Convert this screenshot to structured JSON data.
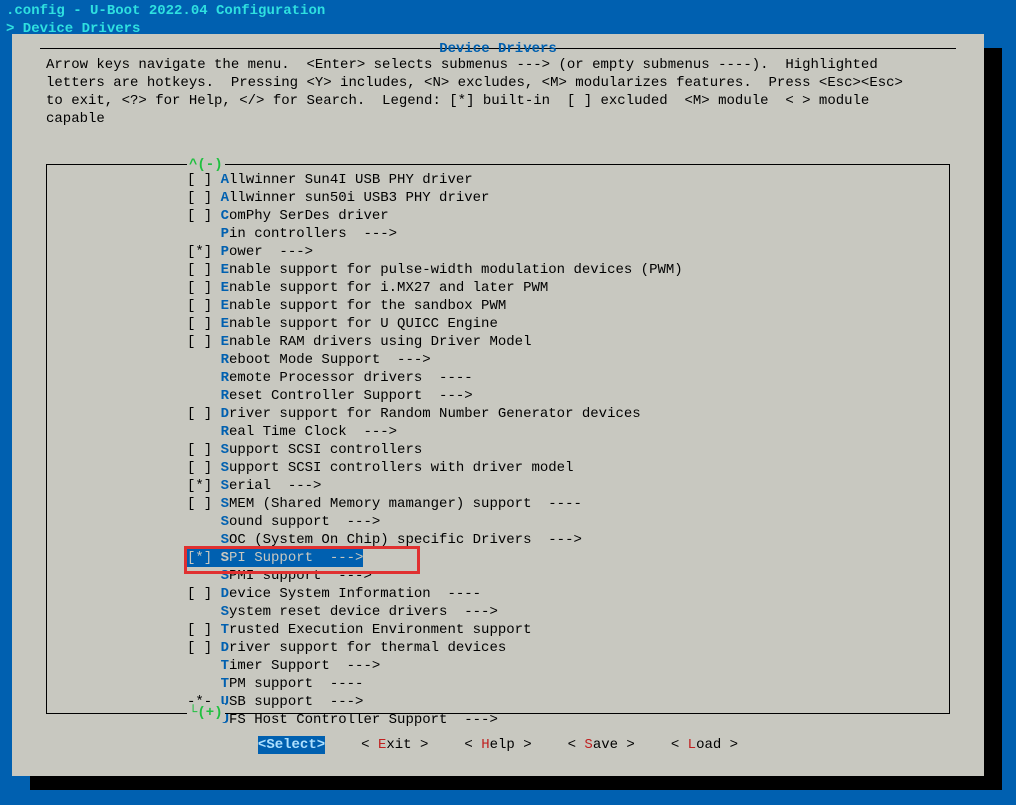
{
  "header": {
    "title": ".config - U-Boot 2022.04 Configuration",
    "breadcrumb": "> Device Drivers"
  },
  "panel": {
    "title": " Device Drivers ",
    "instructions": "Arrow keys navigate the menu.  <Enter> selects submenus ---> (or empty submenus ----).  Highlighted\nletters are hotkeys.  Pressing <Y> includes, <N> excludes, <M> modularizes features.  Press <Esc><Esc>\nto exit, <?> for Help, </> for Search.  Legend: [*] built-in  [ ] excluded  <M> module  < > module\ncapable",
    "scroll_up": "^(-)",
    "scroll_down": "└(+)"
  },
  "items": [
    {
      "prefix": "[ ] ",
      "hk": "A",
      "rest": "llwinner Sun4I USB PHY driver"
    },
    {
      "prefix": "[ ] ",
      "hk": "A",
      "rest": "llwinner sun50i USB3 PHY driver"
    },
    {
      "prefix": "[ ] ",
      "hk": "C",
      "rest": "omPhy SerDes driver"
    },
    {
      "prefix": "    ",
      "hk": "P",
      "rest": "in controllers  --->"
    },
    {
      "prefix": "[*] ",
      "hk": "P",
      "rest": "ower  --->"
    },
    {
      "prefix": "[ ] ",
      "hk": "E",
      "rest": "nable support for pulse-width modulation devices (PWM)"
    },
    {
      "prefix": "[ ] ",
      "hk": "E",
      "rest": "nable support for i.MX27 and later PWM"
    },
    {
      "prefix": "[ ] ",
      "hk": "E",
      "rest": "nable support for the sandbox PWM"
    },
    {
      "prefix": "[ ] ",
      "hk": "E",
      "rest": "nable support for U QUICC Engine"
    },
    {
      "prefix": "[ ] ",
      "hk": "E",
      "rest": "nable RAM drivers using Driver Model"
    },
    {
      "prefix": "    ",
      "hk": "R",
      "rest": "eboot Mode Support  --->"
    },
    {
      "prefix": "    ",
      "hk": "R",
      "rest": "emote Processor drivers  ----"
    },
    {
      "prefix": "    ",
      "hk": "R",
      "rest": "eset Controller Support  --->"
    },
    {
      "prefix": "[ ] ",
      "hk": "D",
      "rest": "river support for Random Number Generator devices"
    },
    {
      "prefix": "    ",
      "hk": "R",
      "rest": "eal Time Clock  --->"
    },
    {
      "prefix": "[ ] ",
      "hk": "S",
      "rest": "upport SCSI controllers"
    },
    {
      "prefix": "[ ] ",
      "hk": "S",
      "rest": "upport SCSI controllers with driver model"
    },
    {
      "prefix": "[*] ",
      "hk": "S",
      "rest": "erial  --->"
    },
    {
      "prefix": "[ ] ",
      "hk": "S",
      "rest": "MEM (Shared Memory mamanger) support  ----"
    },
    {
      "prefix": "    ",
      "hk": "S",
      "rest": "ound support  --->"
    },
    {
      "prefix": "    ",
      "hk": "S",
      "rest": "OC (System On Chip) specific Drivers  --->"
    },
    {
      "prefix": "[*] ",
      "hk": "S",
      "rest": "PI Support  --->",
      "selected": true
    },
    {
      "prefix": "    ",
      "hk": "S",
      "rest": "PMI support  --->"
    },
    {
      "prefix": "[ ] ",
      "hk": "D",
      "rest": "evice System Information  ----"
    },
    {
      "prefix": "    ",
      "hk": "S",
      "rest": "ystem reset device drivers  --->"
    },
    {
      "prefix": "[ ] ",
      "hk": "T",
      "rest": "rusted Execution Environment support"
    },
    {
      "prefix": "[ ] ",
      "hk": "D",
      "rest": "river support for thermal devices"
    },
    {
      "prefix": "    ",
      "hk": "T",
      "rest": "imer Support  --->"
    },
    {
      "prefix": "    ",
      "hk": "T",
      "rest": "PM support  ----"
    },
    {
      "prefix": "-*- ",
      "hk": "U",
      "rest": "SB support  --->"
    },
    {
      "prefix": "    ",
      "hk": "U",
      "rest": "FS Host Controller Support  --->"
    }
  ],
  "buttons": [
    {
      "pre": "<",
      "kw": "Select",
      "post": ">",
      "selected": true
    },
    {
      "pre": "< ",
      "kw": "E",
      "post": "xit >"
    },
    {
      "pre": "< ",
      "kw": "H",
      "post": "elp >"
    },
    {
      "pre": "< ",
      "kw": "S",
      "post": "ave >"
    },
    {
      "pre": "< ",
      "kw": "L",
      "post": "oad >"
    }
  ]
}
